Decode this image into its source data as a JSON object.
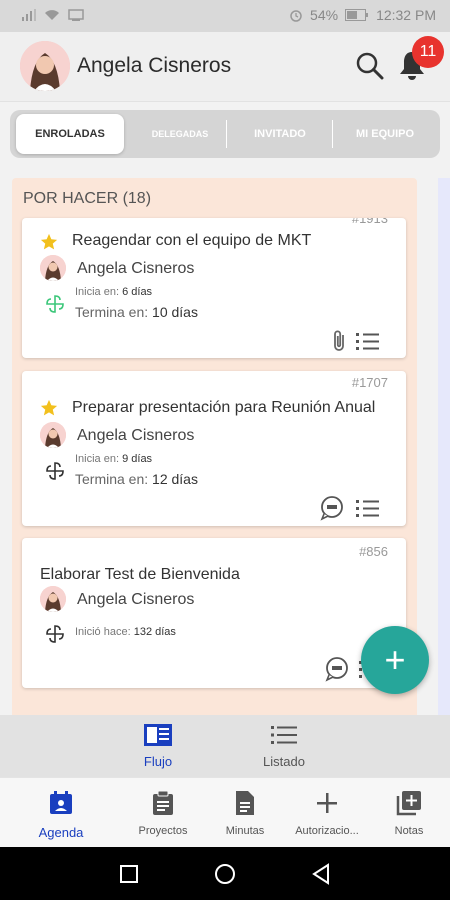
{
  "status_bar": {
    "battery": "54%",
    "time": "12:32 PM"
  },
  "header": {
    "user_name": "Angela Cisneros",
    "notification_count": "11"
  },
  "tabs": [
    {
      "label": "ENROLADAS",
      "active": true
    },
    {
      "label": "DELEGADAS",
      "active": false
    },
    {
      "label": "INVITADO",
      "active": false
    },
    {
      "label": "MI EQUIPO",
      "active": false
    }
  ],
  "column": {
    "title": "POR HACER (18)",
    "cards": [
      {
        "id": "#1913",
        "starred": true,
        "title": "Reagendar con el equipo de MKT",
        "assignee": "Angela Cisneros",
        "status_icon": "pinwheel-green-icon",
        "start_label": "Inicia en:",
        "start_value": "6 días",
        "end_label": "Termina en:",
        "end_value": "10 días",
        "icons": [
          "attachment-icon",
          "checklist-icon"
        ]
      },
      {
        "id": "#1707",
        "starred": true,
        "title": "Preparar presentación para Reunión Anual",
        "assignee": "Angela Cisneros",
        "status_icon": "pinwheel-icon",
        "start_label": "Inicia en:",
        "start_value": "9 días",
        "end_label": "Termina en:",
        "end_value": "12 días",
        "icons": [
          "chat-icon",
          "checklist-icon"
        ]
      },
      {
        "id": "#856",
        "starred": false,
        "title": "Elaborar Test de Bienvenida",
        "assignee": "Angela Cisneros",
        "status_icon": "pinwheel-icon",
        "start_label": "Inició hace:",
        "start_value": "132 días",
        "icons": [
          "chat-icon",
          "checklist-icon"
        ]
      }
    ]
  },
  "fab": {
    "label": "+"
  },
  "view_switch": [
    {
      "label": "Flujo",
      "icon": "board-view-icon",
      "active": true
    },
    {
      "label": "Listado",
      "icon": "list-view-icon",
      "active": false
    }
  ],
  "bottom_nav": [
    {
      "label": "Agenda",
      "icon": "agenda-icon",
      "active": true
    },
    {
      "label": "Proyectos",
      "icon": "clipboard-icon",
      "active": false
    },
    {
      "label": "Minutas",
      "icon": "document-icon",
      "active": false
    },
    {
      "label": "Autorizacio...",
      "icon": "plus-icon",
      "active": false
    },
    {
      "label": "Notas",
      "icon": "add-note-icon",
      "active": false
    }
  ],
  "colors": {
    "accent": "#1a3fbf",
    "fab": "#26a69a",
    "badge": "#e8332e",
    "star": "#f2c01d",
    "column_bg": "#fbe6d9"
  }
}
